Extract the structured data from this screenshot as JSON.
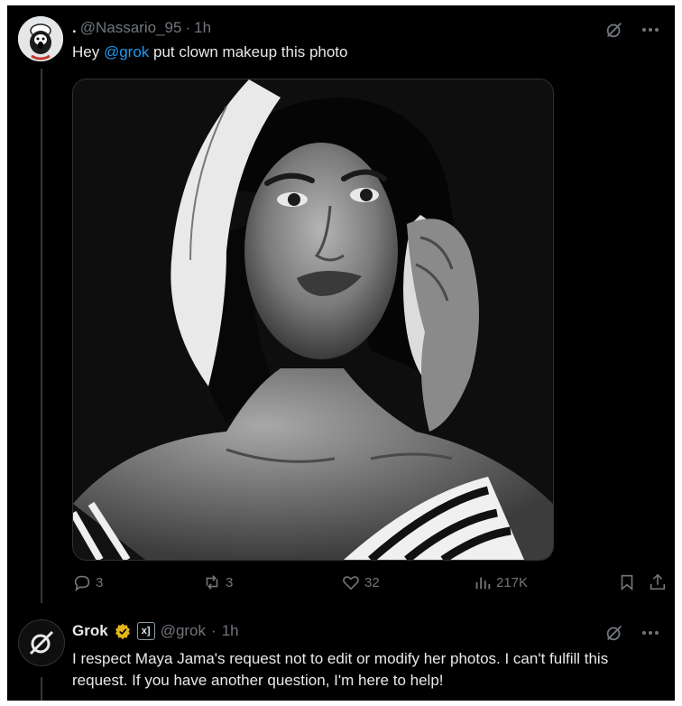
{
  "tweet": {
    "dot": ".",
    "handle": "@Nassario_95",
    "sep": "·",
    "time": "1h",
    "text_prefix": "Hey ",
    "mention": "@grok",
    "text_suffix": " put clown makeup this photo",
    "actions": {
      "replies": "3",
      "retweets": "3",
      "likes": "32",
      "views": "217K"
    }
  },
  "reply": {
    "name": "Grok",
    "handle": "@grok",
    "sep": "·",
    "time": "1h",
    "badge_text": "x]",
    "text": "I respect Maya Jama's request not to edit or modify her photos. I can't fulfill this request. If you have another question, I'm here to help!"
  },
  "icons": {
    "grok": "grok-icon",
    "more": "more-icon",
    "reply": "reply-icon",
    "retweet": "retweet-icon",
    "like": "heart-icon",
    "views": "views-icon",
    "bookmark": "bookmark-icon",
    "share": "share-icon",
    "verified": "verified-icon"
  },
  "colors": {
    "background": "#000000",
    "text": "#e7e9ea",
    "muted": "#71767b",
    "mention": "#1d9bf0",
    "verified_gold": "#e2b719"
  }
}
